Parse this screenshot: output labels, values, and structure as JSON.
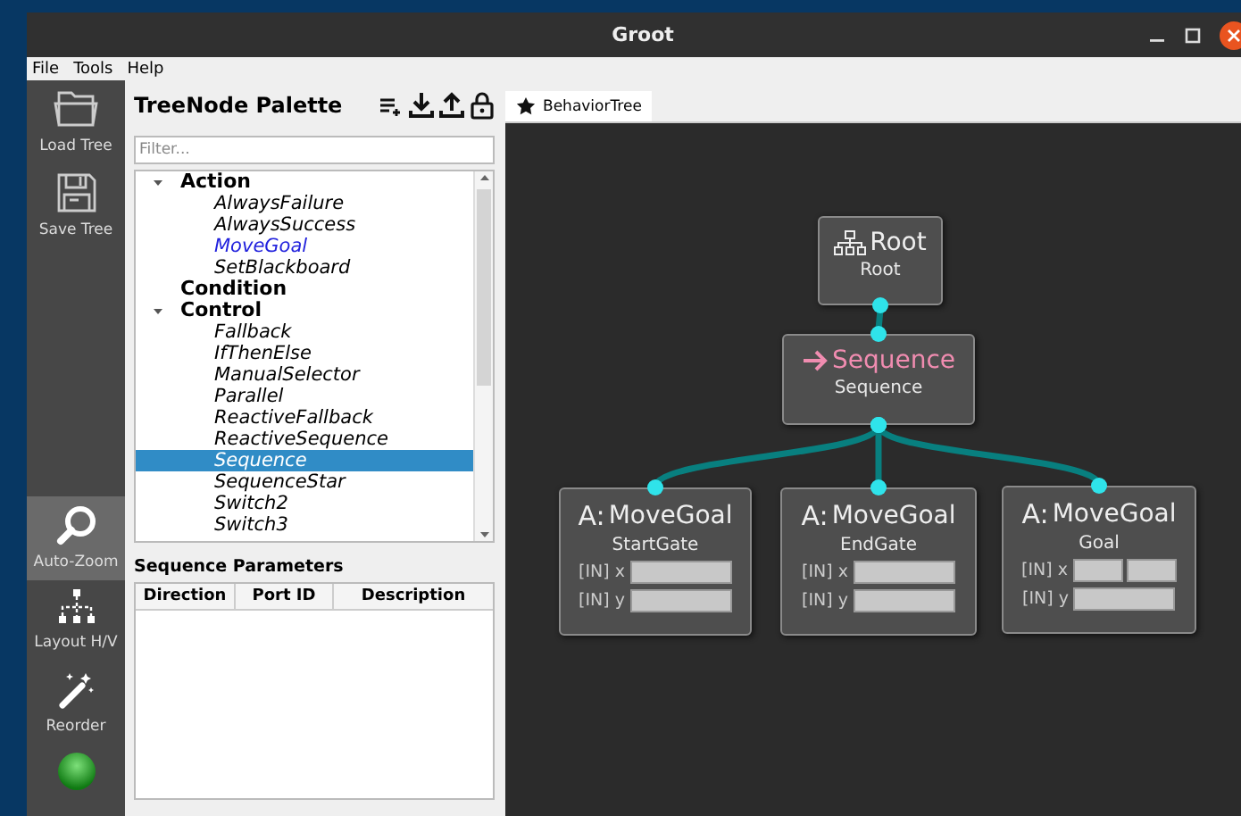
{
  "window": {
    "title": "Groot"
  },
  "menu": [
    "File",
    "Tools",
    "Help"
  ],
  "toolbar": [
    {
      "kind": "load",
      "label": "Load Tree",
      "active": false
    },
    {
      "kind": "save",
      "label": "Save Tree",
      "active": false
    },
    {
      "kind": "zoom",
      "label": "Auto-Zoom",
      "active": true
    },
    {
      "kind": "layout",
      "label": "Layout H/V",
      "active": false
    },
    {
      "kind": "reorder",
      "label": "Reorder",
      "active": false
    },
    {
      "kind": "status"
    }
  ],
  "palette": {
    "title": "TreeNode Palette",
    "filter": {
      "placeholder": "Filter..."
    },
    "tree": [
      {
        "label": "Action",
        "expanded": true,
        "children": [
          {
            "label": "AlwaysFailure",
            "custom": false,
            "selected": false
          },
          {
            "label": "AlwaysSuccess",
            "custom": false,
            "selected": false
          },
          {
            "label": "MoveGoal",
            "custom": true,
            "selected": false
          },
          {
            "label": "SetBlackboard",
            "custom": false,
            "selected": false
          }
        ]
      },
      {
        "label": "Condition"
      },
      {
        "label": "Control",
        "expanded": true,
        "children": [
          {
            "label": "Fallback",
            "custom": false,
            "selected": false
          },
          {
            "label": "IfThenElse",
            "custom": false,
            "selected": false
          },
          {
            "label": "ManualSelector",
            "custom": false,
            "selected": false
          },
          {
            "label": "Parallel",
            "custom": false,
            "selected": false
          },
          {
            "label": "ReactiveFallback",
            "custom": false,
            "selected": false
          },
          {
            "label": "ReactiveSequence",
            "custom": false,
            "selected": false
          },
          {
            "label": "Sequence",
            "custom": false,
            "selected": true
          },
          {
            "label": "SequenceStar",
            "custom": false,
            "selected": false
          },
          {
            "label": "Switch2",
            "custom": false,
            "selected": false
          },
          {
            "label": "Switch3",
            "custom": false,
            "selected": false
          }
        ]
      }
    ]
  },
  "parameters": {
    "title": "Sequence Parameters",
    "columns": [
      "Direction",
      "Port ID",
      "Description"
    ]
  },
  "tabs": [
    {
      "label": "BehaviorTree",
      "selected": true
    }
  ],
  "canvas": {
    "nodes": [
      {
        "kind": "root",
        "title": "Root",
        "name": "Root"
      },
      {
        "kind": "control",
        "title": "Sequence",
        "name": "Sequence"
      },
      {
        "kind": "action",
        "badge": "A:",
        "title": "MoveGoal",
        "name": "StartGate",
        "ports": [
          {
            "label": "[IN] x",
            "kind": "single"
          },
          {
            "label": "[IN] y",
            "kind": "single"
          }
        ]
      },
      {
        "kind": "action",
        "badge": "A:",
        "title": "MoveGoal",
        "name": "EndGate",
        "ports": [
          {
            "label": "[IN] x",
            "kind": "single"
          },
          {
            "label": "[IN] y",
            "kind": "single"
          }
        ]
      },
      {
        "kind": "action",
        "badge": "A:",
        "title": "MoveGoal",
        "name": "Goal",
        "ports": [
          {
            "label": "[IN] x",
            "kind": "pair"
          },
          {
            "label": "[IN] y",
            "kind": "single"
          }
        ]
      }
    ]
  }
}
